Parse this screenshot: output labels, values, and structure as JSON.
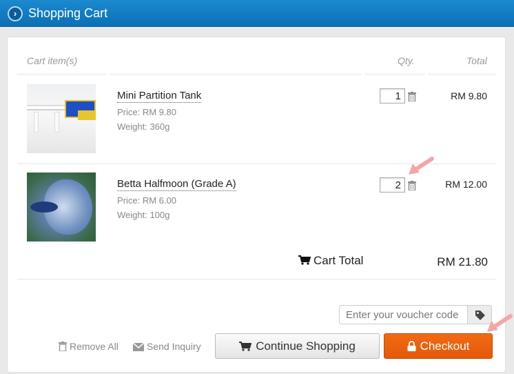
{
  "header": {
    "title": "Shopping Cart",
    "icon": "chevron-right-icon"
  },
  "cart": {
    "col_items": "Cart item(s)",
    "col_qty": "Qty.",
    "col_total": "Total",
    "items": [
      {
        "name": "Mini Partition Tank",
        "price": "Price: RM 9.80",
        "weight": "Weight: 360g",
        "qty": "1",
        "total": "RM 9.80"
      },
      {
        "name": "Betta Halfmoon (Grade A)",
        "price": "Price: RM 6.00",
        "weight": "Weight: 100g",
        "qty": "2",
        "total": "RM 12.00"
      }
    ],
    "cart_total_label": "Cart Total",
    "cart_total_amount": "RM 21.80"
  },
  "voucher": {
    "placeholder": "Enter your voucher code"
  },
  "actions": {
    "remove_all": "Remove All",
    "send_inquiry": "Send Inquiry",
    "continue_shopping": "Continue Shopping",
    "checkout": "Checkout"
  },
  "colors": {
    "header": "#0c6fb4",
    "checkout": "#e8600c",
    "annotation_arrow": "#f4a6a6"
  }
}
